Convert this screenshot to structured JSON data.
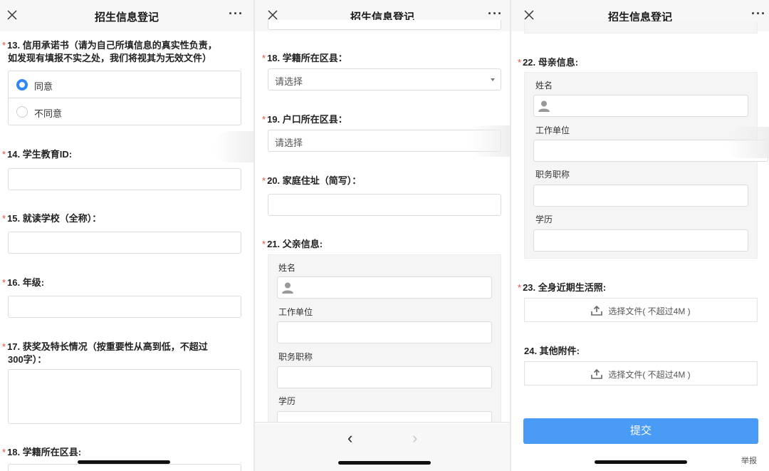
{
  "app": {
    "title": "招生信息登记",
    "more": "···"
  },
  "panel1": {
    "q13": {
      "num": "13.",
      "line1": "信用承诺书（请为自己所填信息的真实性负责，",
      "line2": "如发现有填报不实之处，我们将视其为无效文件）"
    },
    "options": [
      {
        "label": "同意",
        "selected": true
      },
      {
        "label": "不同意",
        "selected": false
      }
    ],
    "q14": "14. 学生教育ID:",
    "q15": "15. 就读学校（全称）：",
    "q16": "16. 年级:",
    "q17": {
      "line1": "17. 获奖及特长情况（按重要性从高到低，不超过",
      "line2": "300字）："
    },
    "q18": "18. 学籍所在区县:"
  },
  "panel2": {
    "q18": "18. 学籍所在区县：",
    "q18_select": "请选择",
    "q19": "19. 户口所在区县：",
    "q19_select": "请选择",
    "q20": "20. 家庭住址（简写）：",
    "q21": "21. 父亲信息:",
    "father": {
      "name": "姓名",
      "employer": "工作单位",
      "title": "职务职称",
      "education": "学历"
    },
    "nav": {
      "back": "‹",
      "forward": "›"
    }
  },
  "panel3": {
    "q22": "22. 母亲信息:",
    "mother": {
      "name": "姓名",
      "employer": "工作单位",
      "title": "职务职称",
      "education": "学历"
    },
    "q23": "23. 全身近期生活照:",
    "upload1": "选择文件( 不超过4M )",
    "q24": "24. 其他附件:",
    "upload2": "选择文件( 不超过4M )",
    "submit": "提交",
    "report": "举报"
  },
  "colors": {
    "accent": "#2f86f6",
    "submit": "#4a9bf5",
    "required": "#e84a3f"
  },
  "required_mark": "*"
}
